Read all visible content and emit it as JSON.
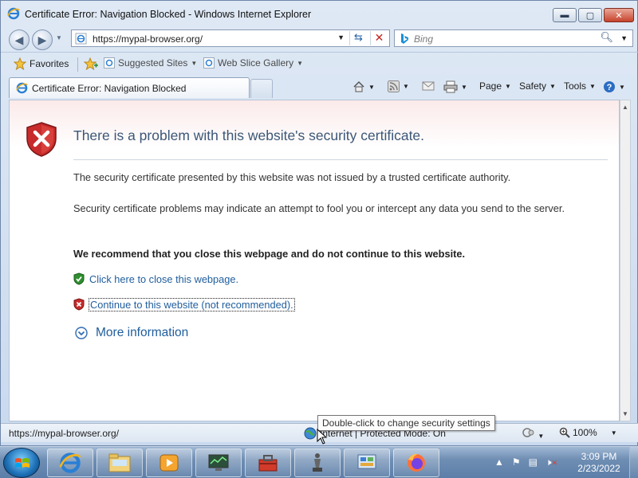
{
  "window": {
    "title": "Certificate Error: Navigation Blocked - Windows Internet Explorer",
    "minimize": "▬",
    "maximize": "▢",
    "close": "✕"
  },
  "address": {
    "url": "https://mypal-browser.org/"
  },
  "search": {
    "placeholder": "Bing"
  },
  "favorites_bar": {
    "favorites_label": "Favorites",
    "suggested_sites": "Suggested Sites",
    "web_slice_gallery": "Web Slice Gallery"
  },
  "tab": {
    "title": "Certificate Error: Navigation Blocked"
  },
  "command_bar": {
    "page": "Page",
    "safety": "Safety",
    "tools": "Tools"
  },
  "content": {
    "headline": "There is a problem with this website's security certificate.",
    "para1": "The security certificate presented by this website was not issued by a trusted certificate authority.",
    "para2": "Security certificate problems may indicate an attempt to fool you or intercept any data you send to the server.",
    "recommend": "We recommend that you close this webpage and do not continue to this website.",
    "close_link": "Click here to close this webpage.",
    "continue_link": "Continue to this website (not recommended).",
    "more_info": "More information"
  },
  "status_bar": {
    "url": "https://mypal-browser.org/",
    "zone": "Internet | Protected Mode: On",
    "zoom": "100%",
    "tooltip": "Double-click to change security settings"
  },
  "taskbar": {
    "time": "3:09 PM",
    "date": "2/23/2022",
    "icons": [
      "ie-icon",
      "explorer-icon",
      "media-player-icon",
      "monitor-app-icon",
      "toolbox-icon",
      "chess-icon",
      "control-panel-icon",
      "firefox-icon"
    ]
  },
  "colors": {
    "link": "#1f5d9c",
    "headline": "#3b5777",
    "danger_shield": "#c0282d",
    "safe_shield": "#2f8f2f"
  }
}
